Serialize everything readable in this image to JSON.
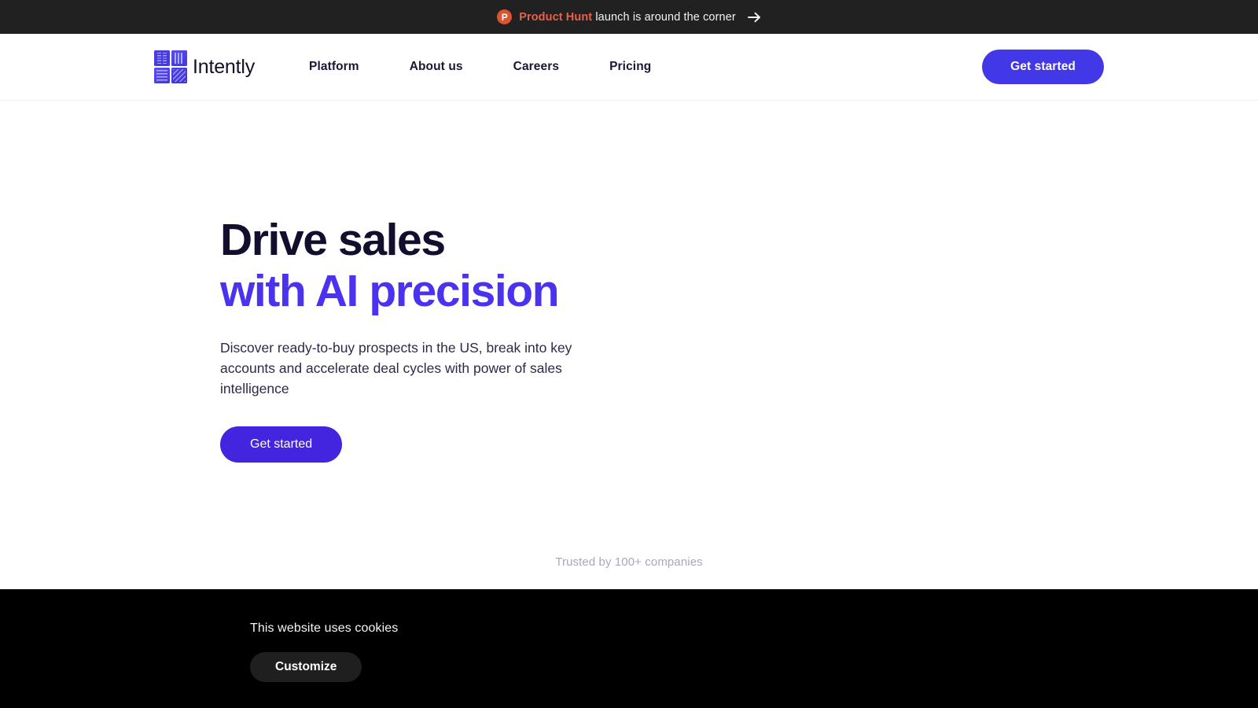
{
  "announcement": {
    "badge_letter": "P",
    "brand": "Product Hunt",
    "message": " launch is around the corner",
    "arrow_icon": "arrow-right-icon",
    "background_color": "#212121",
    "brand_color": "#e8604c",
    "badge_color": "#da552f"
  },
  "header": {
    "brand_name": "Intently",
    "logo_icon": "intently-grid-logo-icon",
    "nav": [
      {
        "label": "Platform"
      },
      {
        "label": "About us"
      },
      {
        "label": "Careers"
      },
      {
        "label": "Pricing"
      }
    ],
    "cta_label": "Get started",
    "cta_color": "#4338e8"
  },
  "hero": {
    "heading_line1": "Drive sales",
    "heading_line2": "with AI precision",
    "heading_color": "#120f2e",
    "accent_color": "#4a32ef",
    "subheading": "Discover ready-to-buy prospects in the US, break into key accounts and accelerate deal cycles with power of sales intelligence",
    "cta_label": "Get started",
    "trusted_text": "Trusted by 100+ companies"
  },
  "cookie_banner": {
    "text": "This website uses cookies",
    "customize_label": "Customize",
    "background_color": "#000000"
  }
}
